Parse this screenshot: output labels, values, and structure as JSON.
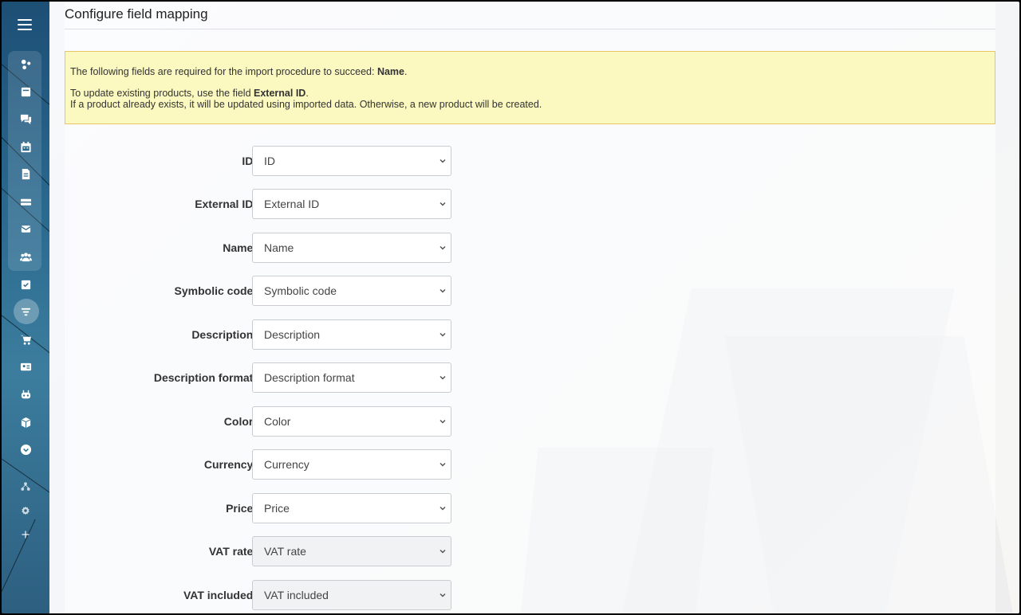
{
  "page": {
    "title": "Configure field mapping"
  },
  "notice": {
    "line1_prefix": "The following fields are required for the import procedure to succeed: ",
    "line1_bold": "Name",
    "line1_suffix": ".",
    "line2_prefix": "To update existing products, use the field ",
    "line2_bold": "External ID",
    "line2_suffix": ".",
    "line3": "If a product already exists, it will be updated using imported data. Otherwise, a new product will be created."
  },
  "fields": [
    {
      "label": "ID:",
      "value": "ID"
    },
    {
      "label": "External ID:",
      "value": "External ID"
    },
    {
      "label": "Name:",
      "value": "Name"
    },
    {
      "label": "Symbolic code:",
      "value": "Symbolic code"
    },
    {
      "label": "Description:",
      "value": "Description"
    },
    {
      "label": "Description format:",
      "value": "Description format"
    },
    {
      "label": "Color:",
      "value": "Color"
    },
    {
      "label": "Currency:",
      "value": "Currency"
    },
    {
      "label": "Price:",
      "value": "Price"
    },
    {
      "label": "VAT rate:",
      "value": "VAT rate"
    },
    {
      "label": "VAT included:",
      "value": "VAT included"
    }
  ],
  "sidebar": {
    "icons": [
      "menu-icon",
      "sites-icon",
      "feed-icon",
      "chat-icon",
      "calendar-icon",
      "document-icon",
      "storage-icon",
      "mail-icon",
      "group-icon",
      "tasks-icon",
      "crm-filter-icon",
      "cart-icon",
      "contact-card-icon",
      "robot-icon",
      "box-icon",
      "more-icon",
      "structure-icon",
      "settings-icon",
      "add-icon"
    ]
  },
  "colors": {
    "notice_bg": "#fbf9c0",
    "notice_border": "#e9c565",
    "sidebar": "#1d4f75"
  }
}
